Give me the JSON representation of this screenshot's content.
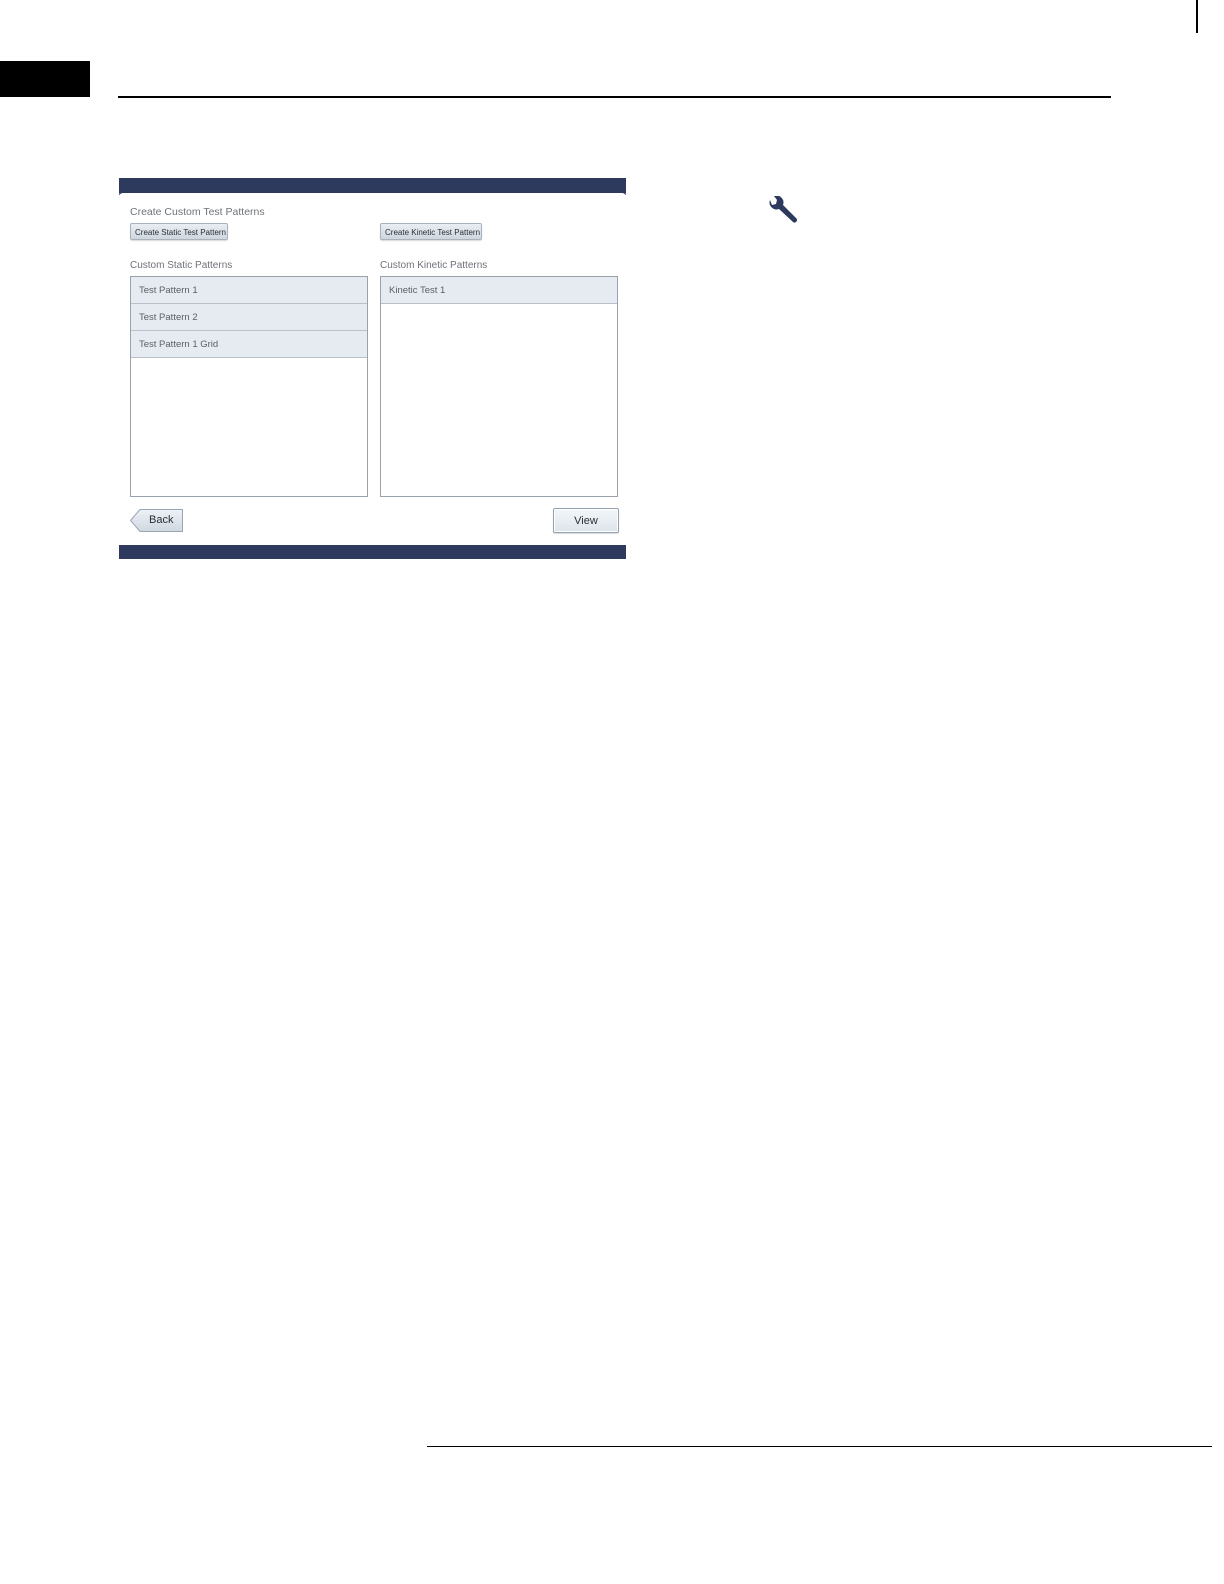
{
  "app": {
    "section_title": "Create Custom Test Patterns",
    "create_static_button": "Create Static Test Pattern",
    "create_kinetic_button": "Create Kinetic Test Pattern",
    "static_list": {
      "label": "Custom Static Patterns",
      "items": [
        "Test Pattern 1",
        "Test Pattern 2",
        "Test Pattern 1 Grid"
      ]
    },
    "kinetic_list": {
      "label": "Custom Kinetic Patterns",
      "items": [
        "Kinetic Test 1"
      ]
    },
    "back_button": "Back",
    "view_button": "View"
  },
  "icons": {
    "tool": "wrench-icon"
  },
  "colors": {
    "window_bar": "#2d3a5e",
    "list_item_bg": "#e5ebf1",
    "text_gray": "#6e7379"
  }
}
